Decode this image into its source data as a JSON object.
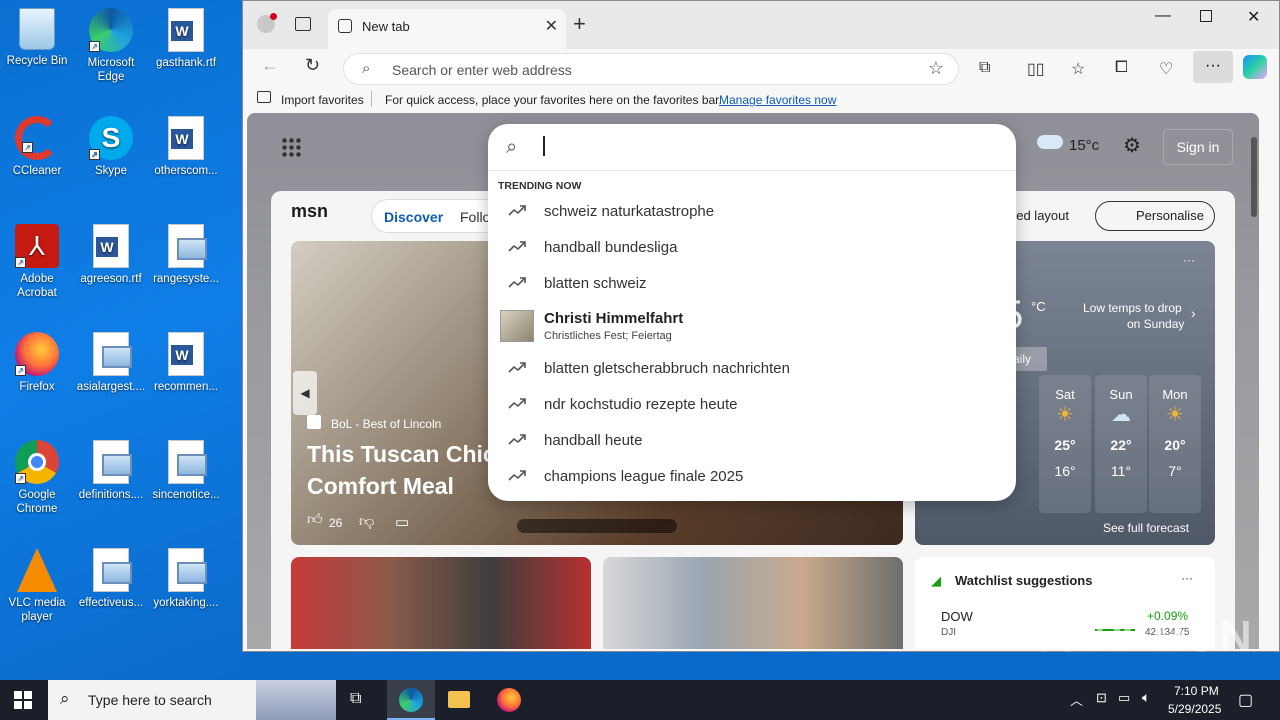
{
  "desktop": {
    "icons": [
      {
        "label": "Recycle Bin"
      },
      {
        "label": "Microsoft Edge"
      },
      {
        "label": "gasthank.rtf"
      },
      {
        "label": "CCleaner"
      },
      {
        "label": "Skype"
      },
      {
        "label": "otherscom..."
      },
      {
        "label": "Adobe Acrobat"
      },
      {
        "label": "agreeson.rtf"
      },
      {
        "label": "rangesyste..."
      },
      {
        "label": "Firefox"
      },
      {
        "label": "asialargest...."
      },
      {
        "label": "recommen..."
      },
      {
        "label": "Google Chrome"
      },
      {
        "label": "definitions...."
      },
      {
        "label": "sincenotice..."
      },
      {
        "label": "VLC media player"
      },
      {
        "label": "effectiveus..."
      },
      {
        "label": "yorktaking...."
      }
    ]
  },
  "browser": {
    "tab_title": "New tab",
    "address_placeholder": "Search or enter web address",
    "favbar": {
      "import": "Import favorites",
      "hint": "For quick access, place your favorites here on the favorites bar.",
      "manage": "Manage favorites now"
    }
  },
  "ntp": {
    "weather_temp": "15°c",
    "sign_in": "Sign in",
    "msn": "msn",
    "tab_discover": "Discover",
    "tab_following": "Follo",
    "feed_layout": "eed layout",
    "personalise": "Personalise",
    "hero": {
      "source": "BoL - Best of Lincoln",
      "headline1": "This Tuscan Chick",
      "headline2": "Comfort Meal",
      "likes": "26"
    },
    "weather_card": {
      "big_temp": "5",
      "unit": "°C",
      "alert1": "Low temps to drop",
      "alert2": "on Sunday",
      "daily": "aily",
      "days": [
        {
          "day": "Sat",
          "hi": "25°",
          "lo": "16°"
        },
        {
          "day": "Sun",
          "hi": "22°",
          "lo": "11°"
        },
        {
          "day": "Mon",
          "hi": "20°",
          "lo": "7°"
        }
      ],
      "see_full": "See full forecast"
    },
    "watchlist": {
      "title": "Watchlist suggestions",
      "symbol": "DOW",
      "sub": "DJI",
      "change": "+0.09%",
      "value": "42,134.75"
    }
  },
  "suggest": {
    "header": "TRENDING NOW",
    "items": [
      "schweiz naturkatastrophe",
      "handball bundesliga",
      "blatten schweiz",
      "Christi Himmelfahrt",
      "blatten gletscherabbruch nachrichten",
      "ndr kochstudio rezepte heute",
      "handball heute",
      "champions league finale 2025"
    ],
    "rich_sub": "Christliches Fest; Feiertag"
  },
  "taskbar": {
    "search_placeholder": "Type here to search",
    "time": "7:10 PM",
    "date": "5/29/2025"
  },
  "watermark": "ANY RUN"
}
